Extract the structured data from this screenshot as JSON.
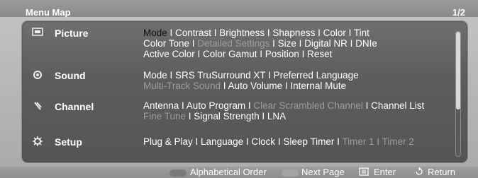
{
  "header": {
    "title": "Menu Map",
    "page": "1/2"
  },
  "categories": [
    {
      "label": "Picture",
      "icon": "picture-icon",
      "lines": [
        [
          {
            "t": "Mode",
            "k": "s"
          },
          {
            "t": " I Contrast I Brightness I Shapness I Color I Tint",
            "k": "n"
          }
        ],
        [
          {
            "t": "Color Tone I ",
            "k": "n"
          },
          {
            "t": "Detailed Settings",
            "k": "d"
          },
          {
            "t": " I Size I Digital NR I DNIe",
            "k": "n"
          }
        ],
        [
          {
            "t": "Active Color I Color Gamut I Position I Reset",
            "k": "n"
          }
        ]
      ]
    },
    {
      "label": "Sound",
      "icon": "sound-icon",
      "lines": [
        [
          {
            "t": "Mode I SRS TruSurround XT I Preferred Language",
            "k": "n"
          }
        ],
        [
          {
            "t": "Multi-Track Sound",
            "k": "d"
          },
          {
            "t": " I Auto Volume I Internal Mute",
            "k": "n"
          }
        ]
      ]
    },
    {
      "label": "Channel",
      "icon": "channel-icon",
      "lines": [
        [
          {
            "t": "Antenna I Auto Program I ",
            "k": "n"
          },
          {
            "t": "Clear Scrambled Channel",
            "k": "d"
          },
          {
            "t": " I Channel List",
            "k": "n"
          }
        ],
        [
          {
            "t": "Fine Tune",
            "k": "d"
          },
          {
            "t": " I Signal Strength I LNA",
            "k": "n"
          }
        ]
      ]
    },
    {
      "label": "Setup",
      "icon": "setup-icon",
      "lines": [
        [
          {
            "t": "Plug & Play I Language I Clock I Sleep Timer I ",
            "k": "n"
          },
          {
            "t": "Timer 1 I Timer 2",
            "k": "d"
          }
        ]
      ]
    }
  ],
  "footer": {
    "alphabetical": "Alphabetical Order",
    "next": "Next Page",
    "enter": "Enter",
    "return": "Return",
    "colors": {
      "alphabetical_pill": "#7a7a7a",
      "next_pill": "#a3a3a3"
    }
  }
}
